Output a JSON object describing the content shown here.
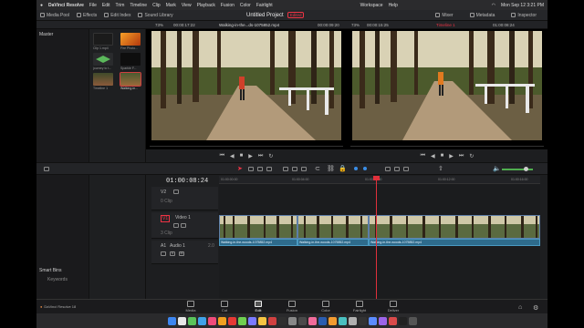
{
  "menubar": {
    "app": "DaVinci Resolve",
    "items": [
      "File",
      "Edit",
      "Trim",
      "Timeline",
      "Clip",
      "Mark",
      "View",
      "Playback",
      "Fusion",
      "Color",
      "Fairlight",
      "Workspace",
      "Help"
    ],
    "datetime": "Mon Sep 12 3:21 PM"
  },
  "toolbar": {
    "left": [
      "Media Pool",
      "Effects",
      "Edit Index",
      "Sound Library"
    ],
    "project_title": "Untitled Project",
    "edited_badge": "Edited",
    "right": [
      "Mixer",
      "Metadata",
      "Inspector"
    ]
  },
  "subbar": {
    "zoom_left": "73%",
    "tc_left": "00:00:17:22",
    "clip_name": "Walking-in-the...ds-1075852.mp4",
    "tc_center": "00:00:09:20",
    "tc_right_src": "00:00:15:25",
    "zoom_right": "73%",
    "timeline_name": "Timeline 1",
    "tc_right": "01:00:08:24"
  },
  "left_panel": {
    "master": "Master",
    "smart_bins": "Smart Bins",
    "keywords": "Keywords"
  },
  "media_pool": {
    "clips": [
      {
        "label": "Clip 1.mp4"
      },
      {
        "label": "Fire Photo..."
      },
      {
        "label": "journey to t..."
      },
      {
        "label": "Sparkle F..."
      },
      {
        "label": "Timeline 1"
      },
      {
        "label": "Walking-in..."
      }
    ]
  },
  "timeline": {
    "timecode": "01:00:08:24",
    "ruler": [
      "01:00:00:00",
      "01:00:04:00",
      "01:00:08:00",
      "01:00:12:00",
      "01:00:16:00"
    ],
    "tracks": [
      {
        "id": "V2",
        "name": "",
        "clips": "0 Clip"
      },
      {
        "id": "V1",
        "name": "Video 1",
        "clips": "3 Clip"
      },
      {
        "id": "A1",
        "name": "Audio 1",
        "channels": "2.0"
      }
    ],
    "clips": [
      {
        "name": "Walking-in-the-woods-1075852.mp4"
      },
      {
        "name": "Walking-in-the-woods-1075852.mp4"
      },
      {
        "name": "Walking-in-the-woods-1075852.mp4"
      }
    ]
  },
  "pages": [
    {
      "label": "Media"
    },
    {
      "label": "Cut"
    },
    {
      "label": "Edit"
    },
    {
      "label": "Fusion"
    },
    {
      "label": "Color"
    },
    {
      "label": "Fairlight"
    },
    {
      "label": "Deliver"
    }
  ],
  "active_page": "Edit",
  "product": "DaVinci Resolve 18",
  "colors": {
    "playhead": "#e0303b",
    "video_clip": "#3c4f6a",
    "audio_clip": "#2e6b8c",
    "accent_blue": "#3a8ee6"
  },
  "dock_colors": [
    "#3d86f0",
    "#e8e8e8",
    "#5ac35a",
    "#3fa2e8",
    "#ee4b7a",
    "#f0a020",
    "#e53935",
    "#6fcf50",
    "#7a7aff",
    "#f5c542",
    "#d04040",
    "#2f2f2f",
    "#888888",
    "#4a4a4a",
    "#f06b9a",
    "#2a5db0",
    "#f29b30",
    "#4ac0c0",
    "#b0b0b0",
    "#333333",
    "#5b8cff",
    "#9c64e8",
    "#d94a4a",
    "#222222",
    "#555555"
  ]
}
